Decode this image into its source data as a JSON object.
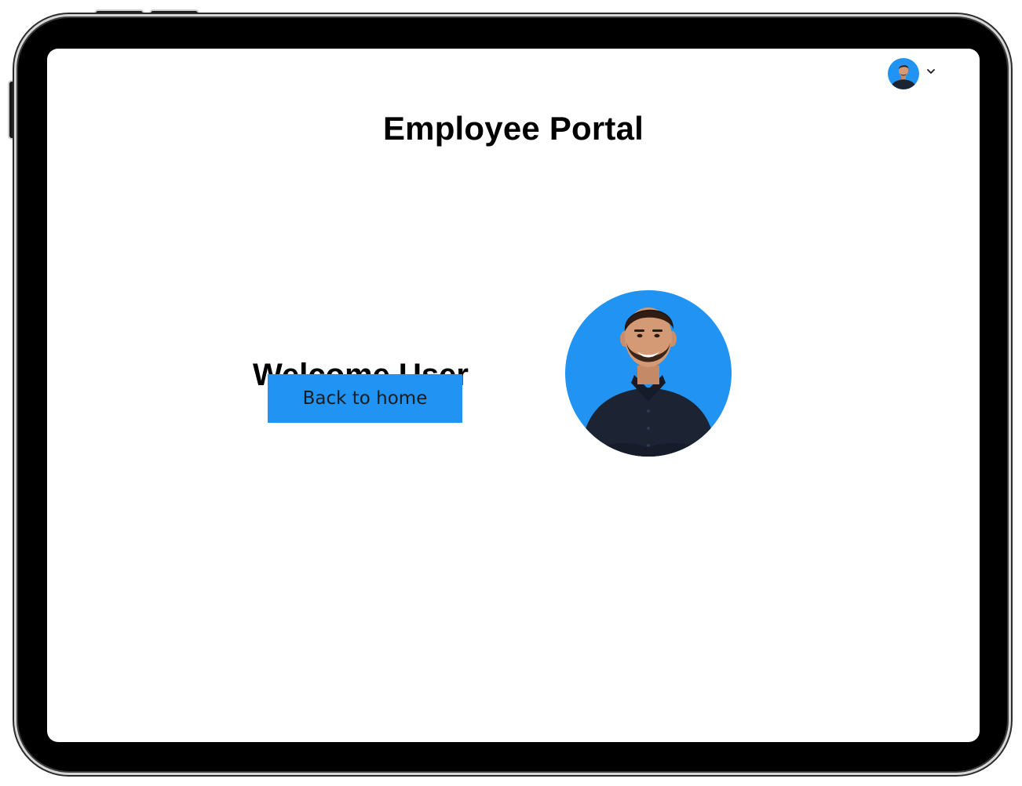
{
  "app": {
    "title": "Employee Portal"
  },
  "header": {
    "account_menu": {
      "avatar_icon": "user-avatar-icon",
      "chevron_icon": "chevron-down-icon"
    }
  },
  "main": {
    "welcome_heading": "Welcome User",
    "back_button_label": "Back to home",
    "profile_photo_icon": "profile-photo"
  },
  "colors": {
    "accent": "#2194f3",
    "text": "#000000",
    "device_frame": "#000000",
    "shirt": "#1c2333"
  }
}
